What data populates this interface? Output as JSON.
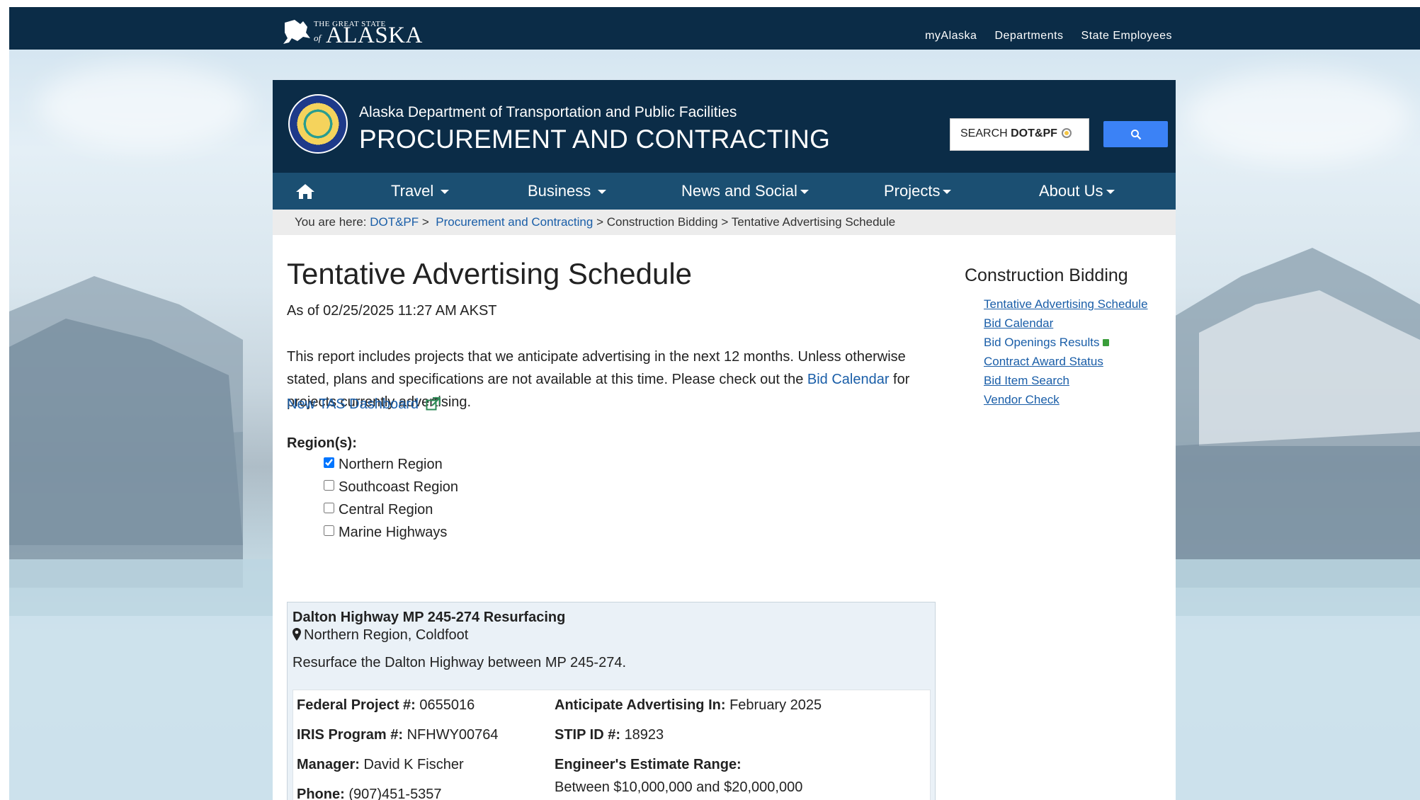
{
  "topbar": {
    "logo_small": "THE GREAT STATE",
    "logo_of": "of",
    "logo_big": "ALASKA",
    "links": [
      "myAlaska",
      "Departments",
      "State Employees"
    ]
  },
  "header": {
    "department": "Alaska Department of Transportation and Public Facilities",
    "section": "PROCUREMENT AND CONTRACTING",
    "search_placeholder_prefix": "SEARCH ",
    "search_placeholder_bold": "DOT&PF"
  },
  "nav": {
    "items": [
      "Travel",
      "Business",
      "News and Social",
      "Projects",
      "About Us"
    ]
  },
  "breadcrumb": {
    "prefix": "You are here:",
    "crumb1": "DOT&PF",
    "crumb2": "Procurement and Contracting",
    "crumb3": "Construction Bidding",
    "crumb4": "Tentative Advertising Schedule",
    "sep": ">"
  },
  "page": {
    "title": "Tentative Advertising Schedule",
    "as_of": "As of 02/25/2025 11:27 AM AKST",
    "intro_text": "This report includes projects that we anticipate advertising in the next 12 months. Unless otherwise stated, plans and specifications are not available at this time. Please check out the ",
    "intro_link": "Bid Calendar",
    "intro_tail": " for projects currently advertising.",
    "tas_link": "New TAS Dashboard",
    "regions_label": "Region(s):",
    "regions": [
      {
        "label": "Northern Region",
        "checked": true
      },
      {
        "label": "Southcoast Region",
        "checked": false
      },
      {
        "label": "Central Region",
        "checked": false
      },
      {
        "label": "Marine Highways",
        "checked": false
      }
    ]
  },
  "project": {
    "title": "Dalton Highway MP 245-274 Resurfacing",
    "location": "Northern Region, Coldfoot",
    "description": "Resurface the Dalton Highway between MP 245-274.",
    "federal_label": "Federal Project #:",
    "federal_value": "0655016",
    "iris_label": "IRIS Program #:",
    "iris_value": "NFHWY00764",
    "manager_label": "Manager:",
    "manager_value": "David K Fischer",
    "phone_label": "Phone:",
    "phone_value": "(907)451-5357",
    "advertising_label": "Anticipate Advertising In:",
    "advertising_value": "February 2025",
    "stip_label": "STIP ID #:",
    "stip_value": "18923",
    "estimate_label": "Engineer's Estimate Range:",
    "estimate_value": "Between $10,000,000 and $20,000,000"
  },
  "sidebar": {
    "heading": "Construction Bidding",
    "links": [
      "Tentative Advertising Schedule",
      "Bid Calendar",
      "Bid Openings Results",
      "Contract Award Status",
      "Bid Item Search",
      "Vendor Check"
    ]
  },
  "colors": {
    "navy": "#0b2c47",
    "nav_blue": "#1b4f72",
    "link": "#1a5ea8",
    "search_button": "#3b82f6"
  }
}
